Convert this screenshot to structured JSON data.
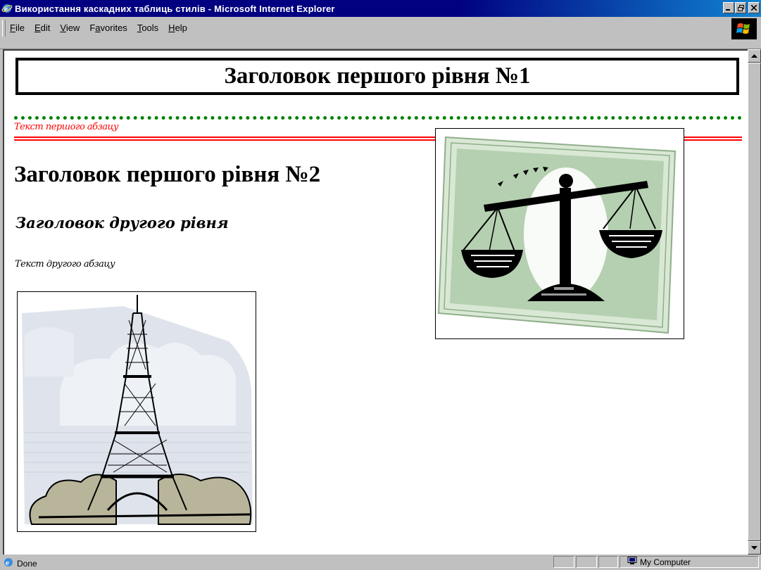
{
  "window": {
    "title": "Використання каскадних таблиць стилів - Microsoft Internet Explorer",
    "buttons": [
      "minimize",
      "maximize",
      "close"
    ]
  },
  "menu": {
    "items": [
      {
        "label": "File",
        "accel": "F"
      },
      {
        "label": "Edit",
        "accel": "E"
      },
      {
        "label": "View",
        "accel": "V"
      },
      {
        "label": "Favorites",
        "accel": "a"
      },
      {
        "label": "Tools",
        "accel": "T"
      },
      {
        "label": "Help",
        "accel": "H"
      }
    ]
  },
  "page": {
    "heading1_first": "Заголовок першого рівня №1",
    "paragraph1": "Текст першого абзацу",
    "heading1_second": "Заголовок першого рівня №2",
    "heading2": "Заголовок другого рівня",
    "paragraph2": "Текст другого абзацу",
    "images": [
      "scales-of-justice",
      "eiffel-tower"
    ]
  },
  "status": {
    "text": "Done",
    "zone": "My Computer"
  },
  "colors": {
    "titlebar": "#000080",
    "paragraph1": "#ff0000",
    "separator_dotted": "#008000",
    "separator_double": "#ff0000"
  }
}
